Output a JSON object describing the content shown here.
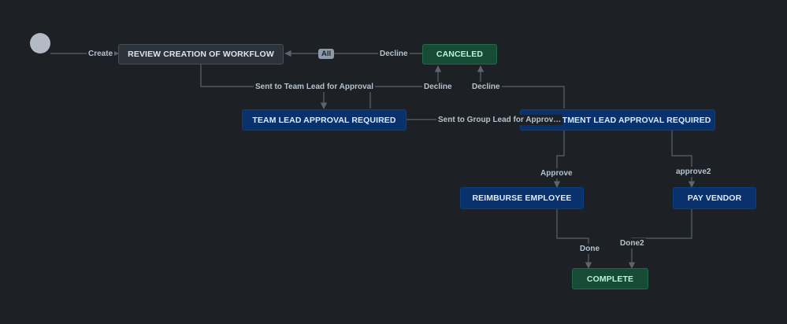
{
  "diagram": {
    "nodes": {
      "review": "REVIEW CREATION OF WORKFLOW",
      "canceled": "CANCELED",
      "team_lead": "TEAM LEAD APPROVAL REQUIRED",
      "dept_lead": "RTMENT LEAD APPROVAL REQUIRED",
      "reimburse": "REIMBURSE EMPLOYEE",
      "pay_vendor": "PAY VENDOR",
      "complete": "COMPLETE"
    },
    "transitions": {
      "create": "Create",
      "all": "All",
      "decline_top": "Decline",
      "sent_team_lead": "Sent to Team Lead for Approval",
      "decline_team": "Decline",
      "decline_dept": "Decline",
      "sent_group_lead": "Sent to Group Lead for Approv…",
      "approve": "Approve",
      "approve2": "approve2",
      "done": "Done",
      "done2": "Done2"
    },
    "colors": {
      "background": "#1d2025",
      "edge": "#5c646e",
      "todo": "#2c333a",
      "in_progress": "#09326c",
      "done": "#164b35",
      "start": "#b3bac5"
    }
  }
}
